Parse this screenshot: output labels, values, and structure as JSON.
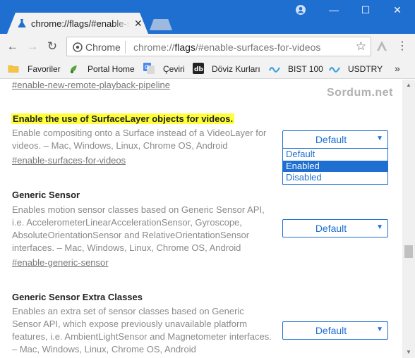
{
  "window": {
    "tab_title": "chrome://flags/#enable-surfaces-for-videos",
    "tab_close": "✕",
    "profile_icon": "profile-icon",
    "minimize": "—",
    "maximize": "☐",
    "close": "✕",
    "colors": {
      "titlebar": "#1f6fd1",
      "tab": "#f2f2f2"
    }
  },
  "toolbar": {
    "back": "←",
    "forward": "→",
    "reload": "↻",
    "omnibox_label": "Chrome",
    "url_prefix": "chrome://",
    "url_host": "flags",
    "url_rest": "/#enable-surfaces-for-videos",
    "star": "☆",
    "menu": "⋮"
  },
  "bookmarks": {
    "items": [
      {
        "label": "Favoriler"
      },
      {
        "label": "Portal Home"
      },
      {
        "label": "Çeviri"
      },
      {
        "label": "Döviz Kurları"
      },
      {
        "label": "BIST 100"
      },
      {
        "label": "USDTRY"
      }
    ],
    "more": "»"
  },
  "content": {
    "watermark": "Sordum.net",
    "prev_link": "#enable-new-remote-playback-pipeline",
    "flags": [
      {
        "title": "Enable the use of SurfaceLayer objects for videos.",
        "description": "Enable compositing onto a Surface instead of a VideoLayer for videos. – Mac, Windows, Linux, Chrome OS, Android",
        "link": "#enable-surfaces-for-videos",
        "value": "Default",
        "highlighted": true
      },
      {
        "title": "Generic Sensor",
        "description": "Enables motion sensor classes based on Generic Sensor API, i.e. AccelerometerLinearAccelerationSensor, Gyroscope, AbsoluteOrientationSensor and RelativeOrientationSensor interfaces. – Mac, Windows, Linux, Chrome OS, Android",
        "link": "#enable-generic-sensor",
        "value": "Default"
      },
      {
        "title": "Generic Sensor Extra Classes",
        "description": "Enables an extra set of sensor classes based on Generic Sensor API, which expose previously unavailable platform features, i.e. AmbientLightSensor and Magnetometer interfaces. – Mac, Windows, Linux, Chrome OS, Android",
        "value": "Default"
      }
    ],
    "dropdown_options": [
      "Default",
      "Enabled",
      "Disabled"
    ],
    "dropdown_selected": "Enabled",
    "arrow": "▼"
  },
  "scrollbar": {
    "up": "▲",
    "down": "▼"
  }
}
